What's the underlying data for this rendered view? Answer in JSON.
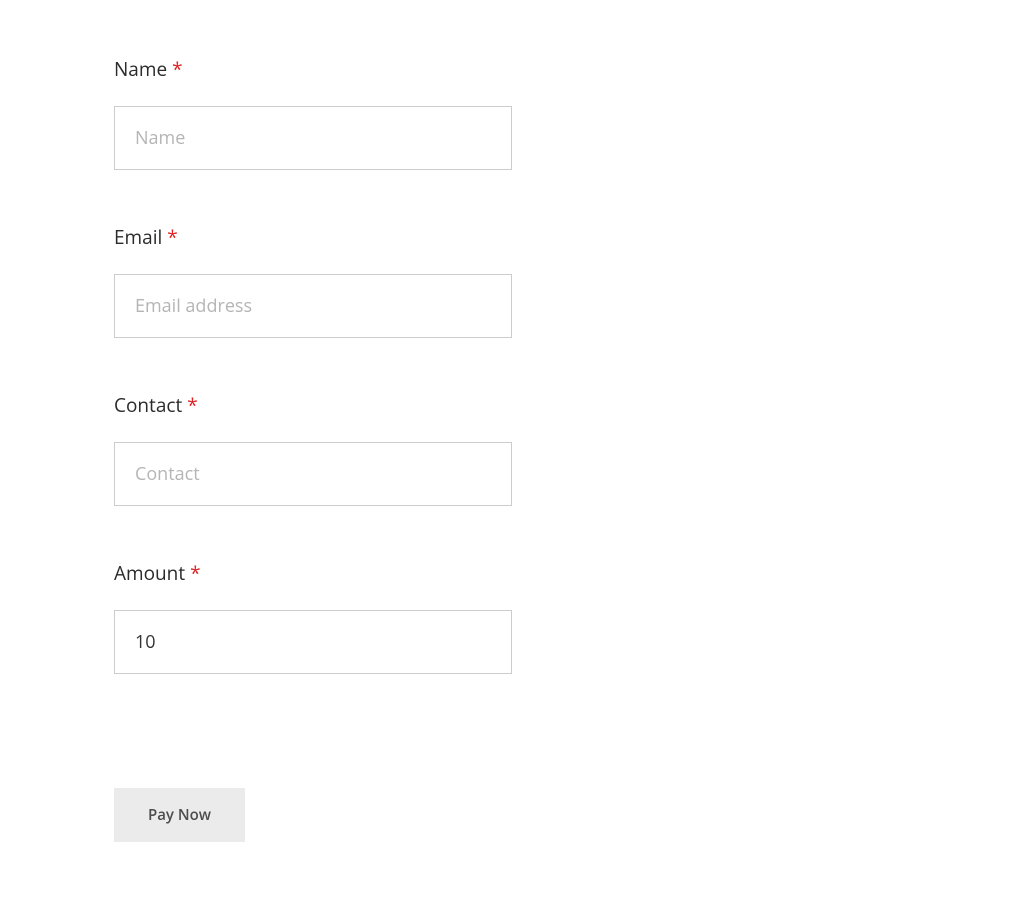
{
  "form": {
    "required_marker": "*",
    "fields": {
      "name": {
        "label": "Name",
        "placeholder": "Name",
        "value": ""
      },
      "email": {
        "label": "Email",
        "placeholder": "Email address",
        "value": ""
      },
      "contact": {
        "label": "Contact",
        "placeholder": "Contact",
        "value": ""
      },
      "amount": {
        "label": "Amount",
        "placeholder": "",
        "value": "10"
      }
    },
    "submit_label": "Pay Now"
  }
}
